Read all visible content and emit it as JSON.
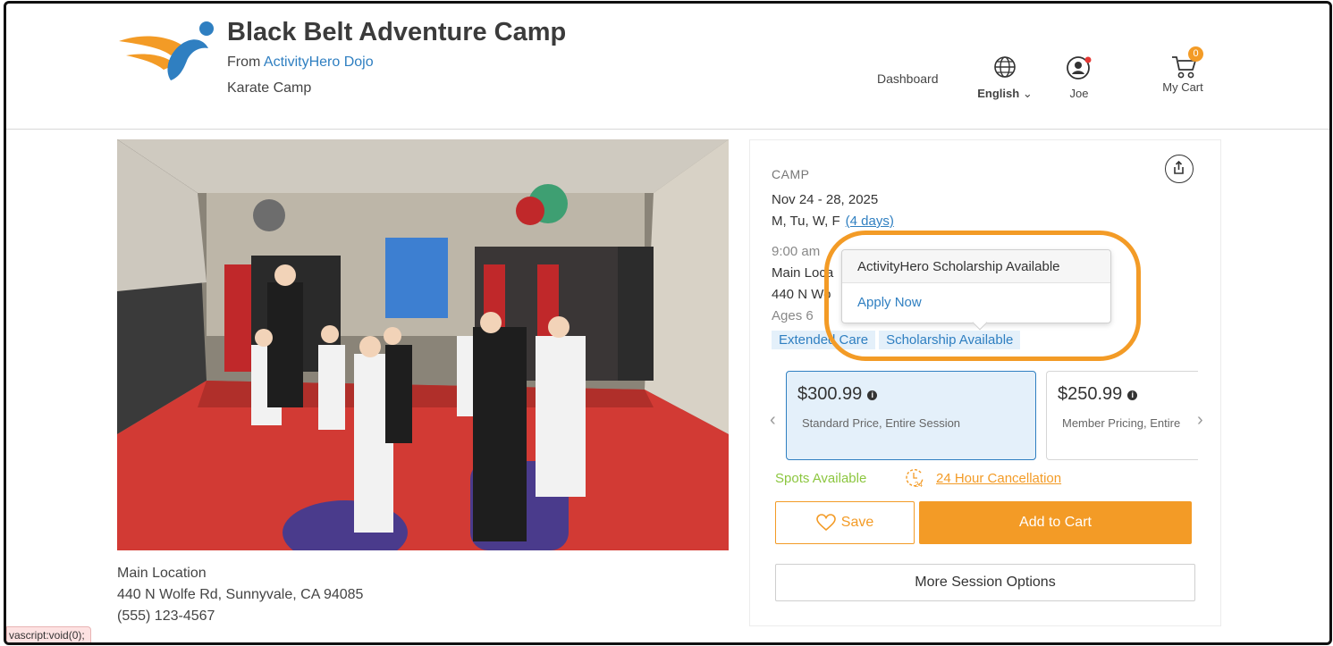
{
  "header": {
    "title": "Black Belt Adventure Camp",
    "from_prefix": "From",
    "provider": "ActivityHero Dojo",
    "category": "Karate Camp",
    "nav": {
      "dashboard": "Dashboard",
      "language": "English",
      "user": "Joe",
      "cart_label": "My Cart",
      "cart_count": "0"
    }
  },
  "location": {
    "name": "Main Location",
    "address": "440 N Wolfe Rd, Sunnyvale, CA 94085",
    "phone": "(555) 123-4567"
  },
  "status_bar": "vascript:void(0);",
  "session": {
    "type": "CAMP",
    "dates": "Nov 24 - 28, 2025",
    "days": "M, Tu, W, F",
    "days_link": "(4 days)",
    "time": "9:00 am",
    "location_short": "Main Loca",
    "address_short": "440 N Wo",
    "ages": "Ages 6",
    "tags": [
      "Extended Care",
      "Scholarship Available"
    ]
  },
  "pricing": [
    {
      "amount": "$300.99",
      "description": "Standard Price, Entire Session",
      "selected": true
    },
    {
      "amount": "$250.99",
      "description": "Member Pricing, Entire",
      "selected": false
    }
  ],
  "availability": "Spots Available",
  "cancellation": "24 Hour Cancellation",
  "buttons": {
    "save": "Save",
    "add_to_cart": "Add to Cart",
    "more_sessions": "More Session Options"
  },
  "popover": {
    "title": "ActivityHero Scholarship Available",
    "link": "Apply Now"
  },
  "colors": {
    "accent_orange": "#f39b26",
    "link_blue": "#2f7fc1",
    "available_green": "#8cc63f",
    "selected_bg": "#e4f0fa"
  }
}
